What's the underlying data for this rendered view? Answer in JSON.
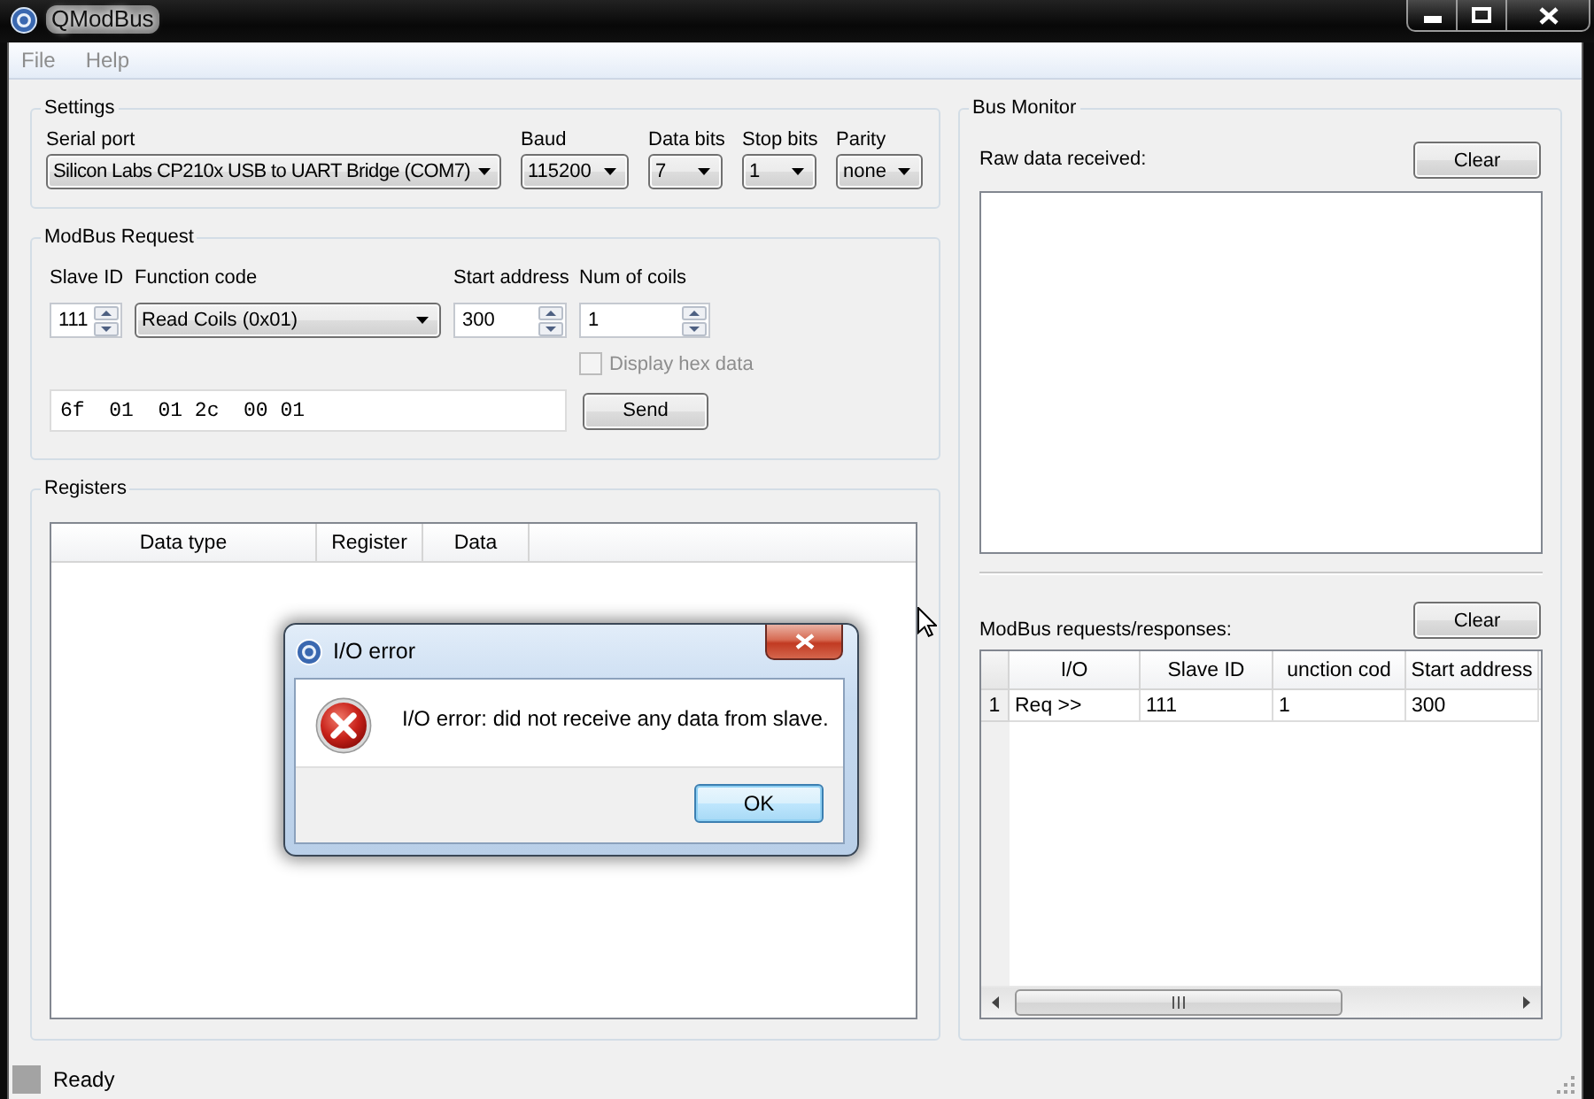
{
  "window": {
    "title": "QModBus"
  },
  "menu": [
    {
      "label": "File",
      "disabled": true
    },
    {
      "label": "Help",
      "disabled": true
    }
  ],
  "settings": {
    "title": "Settings",
    "fields": [
      {
        "kind": "combo",
        "label": "Serial port",
        "value": "Silicon Labs CP210x USB to UART Bridge (COM7)"
      },
      {
        "kind": "combo",
        "label": "Baud",
        "value": "115200"
      },
      {
        "kind": "combo",
        "label": "Data bits",
        "value": "7"
      },
      {
        "kind": "combo",
        "label": "Stop bits",
        "value": "1"
      },
      {
        "kind": "combo",
        "label": "Parity",
        "value": "none"
      }
    ]
  },
  "modbus_request": {
    "title": "ModBus Request",
    "fields": [
      {
        "kind": "spin",
        "label": "Slave ID",
        "value": "111"
      },
      {
        "kind": "combo",
        "label": "Function code",
        "value": "Read Coils (0x01)"
      },
      {
        "kind": "spin",
        "label": "Start address",
        "value": "300"
      },
      {
        "kind": "spin",
        "label": "Num of coils",
        "value": "1"
      }
    ],
    "display_hex": {
      "label": "Display hex data",
      "checked": false,
      "disabled": true
    },
    "raw_request": {
      "value": "6f  01  01 2c  00 01"
    },
    "send_button": "Send"
  },
  "registers": {
    "title": "Registers",
    "columns": [
      "Data type",
      "Register",
      "Data"
    ]
  },
  "bus_monitor": {
    "title": "Bus Monitor",
    "raw_data": {
      "label": "Raw data received:",
      "clear_button": "Clear"
    },
    "requests": {
      "label": "ModBus requests/responses:",
      "clear_button": "Clear",
      "columns": [
        "I/O",
        "Slave ID",
        "unction cod",
        "Start address"
      ],
      "rows": [
        {
          "number": "1",
          "cells": [
            "Req >>",
            "111",
            "1",
            "300"
          ]
        }
      ]
    }
  },
  "status_bar": {
    "text": "Ready"
  },
  "dialog": {
    "title": "I/O error",
    "message": "I/O error: did not receive any data from slave.",
    "buttons": [
      {
        "label": "OK",
        "default": true
      }
    ]
  }
}
